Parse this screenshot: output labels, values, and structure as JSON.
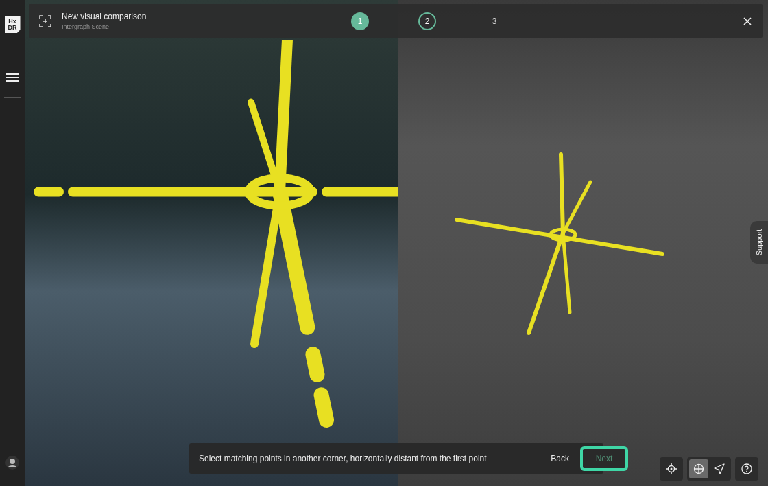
{
  "sidebar": {
    "logo_top": "Hx",
    "logo_bottom": "DR"
  },
  "header": {
    "title": "New visual comparison",
    "subtitle": "Intergraph Scene",
    "steps": [
      {
        "label": "1",
        "completed": true,
        "selected": false
      },
      {
        "label": "2",
        "completed": false,
        "selected": true
      },
      {
        "label": "3",
        "completed": false,
        "selected": false
      }
    ]
  },
  "instruction_bar": {
    "text": "Select matching points in another corner, horizontally distant from the first point",
    "back_label": "Back",
    "next": {
      "label": "Next",
      "disabled": true,
      "highlighted": true
    }
  },
  "toolbar": {
    "groups": [
      [
        {
          "kind": "target",
          "selected": false
        }
      ],
      [
        {
          "kind": "globe",
          "selected": true
        },
        {
          "kind": "send",
          "selected": false
        }
      ],
      [
        {
          "kind": "help",
          "selected": false
        }
      ]
    ]
  },
  "support_tab": {
    "label": "Support"
  }
}
